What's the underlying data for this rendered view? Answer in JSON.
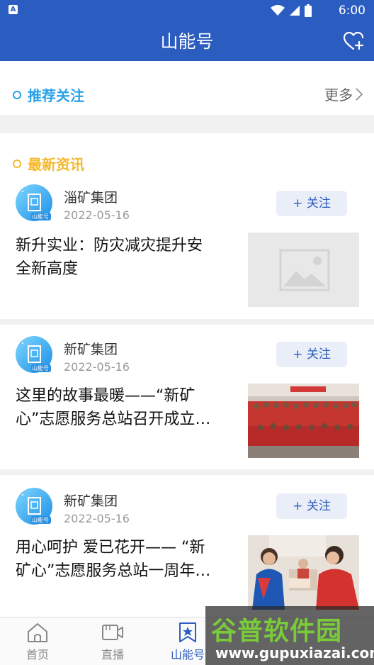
{
  "status_bar": {
    "time": "6:00",
    "notification_glyph": "A"
  },
  "header": {
    "title": "山能号"
  },
  "recommended": {
    "title": "推荐关注",
    "more_label": "更多"
  },
  "latest": {
    "title": "最新资讯"
  },
  "articles": [
    {
      "publisher": "淄矿集团",
      "date": "2022-05-16",
      "follow_label": "+ 关注",
      "line1": "新升实业：防灾减灾提升安",
      "line2": "全新高度",
      "thumb": "placeholder-image"
    },
    {
      "publisher": "新矿集团",
      "date": "2022-05-16",
      "follow_label": "+ 关注",
      "line1": "这里的故事最暖——“新矿",
      "line2": "心”志愿服务总站召开成立…",
      "thumb": "group-photo"
    },
    {
      "publisher": "新矿集团",
      "date": "2022-05-16",
      "follow_label": "+ 关注",
      "line1": "用心呵护 爱已花开—— “新",
      "line2": "矿心”志愿服务总站一周年…",
      "thumb": "volunteer-photo"
    }
  ],
  "avatar_badge": "山能号",
  "tabs": [
    {
      "label": "首页",
      "icon": "home-icon"
    },
    {
      "label": "直播",
      "icon": "video-icon"
    },
    {
      "label": "山能号",
      "icon": "bookmark-star-icon"
    }
  ],
  "watermark": {
    "title": "谷普软件园",
    "url": "www.gupuxiazai.com"
  },
  "colors": {
    "primary": "#2b5cbf",
    "accent_blue": "#2aa2e8",
    "accent_yellow": "#f5b82e"
  }
}
